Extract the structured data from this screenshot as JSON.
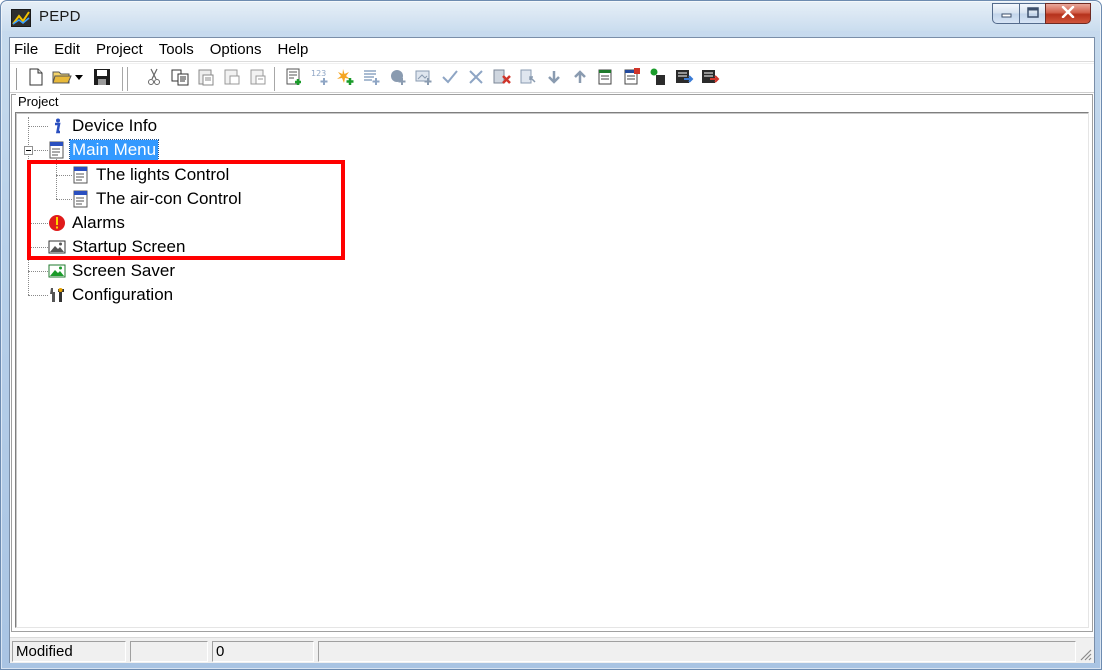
{
  "window": {
    "title": "PEPD",
    "app_icon": "pepd-app-icon",
    "caption_buttons": [
      "minimize-icon",
      "maximize-icon",
      "close-icon"
    ]
  },
  "menu": {
    "items": [
      "File",
      "Edit",
      "Project",
      "Tools",
      "Options",
      "Help"
    ]
  },
  "toolbar": {
    "buttons": [
      "new-file-icon",
      "open-folder-icon",
      "dropdown-arrow-icon",
      "save-icon",
      "cut-icon",
      "copy-icon",
      "paste-icon",
      "paste-special-icon",
      "paste-item-icon",
      "add-menu-icon",
      "add-number-icon",
      "add-action-icon",
      "add-list-icon",
      "add-alarm-icon",
      "add-screen-icon",
      "check-icon",
      "cross-icon",
      "delete-icon",
      "move-icon",
      "move-down-icon",
      "move-up-icon",
      "menu-item-icon",
      "menu-red-icon",
      "menu-green-icon",
      "export-icon",
      "import-icon"
    ]
  },
  "project": {
    "group_label": "Project",
    "tree": [
      {
        "label": "Device Info",
        "icon": "info-icon",
        "level": 0
      },
      {
        "label": "Main Menu",
        "icon": "menu-page-icon",
        "level": 0,
        "selected": true,
        "expanded": true
      },
      {
        "label": "The lights Control",
        "icon": "menu-page-icon",
        "level": 1
      },
      {
        "label": "The air-con Control",
        "icon": "menu-page-icon",
        "level": 1
      },
      {
        "label": "Alarms",
        "icon": "alarm-icon",
        "level": 0
      },
      {
        "label": "Startup Screen",
        "icon": "image-icon",
        "level": 0
      },
      {
        "label": "Screen Saver",
        "icon": "screen-saver-icon",
        "level": 0
      },
      {
        "label": "Configuration",
        "icon": "tools-icon",
        "level": 0
      }
    ]
  },
  "statusbar": {
    "status": "Modified",
    "panel2": "",
    "count": "0",
    "panel4": ""
  },
  "colors": {
    "selection": "#3399ff",
    "highlight_box": "#ff0000"
  }
}
